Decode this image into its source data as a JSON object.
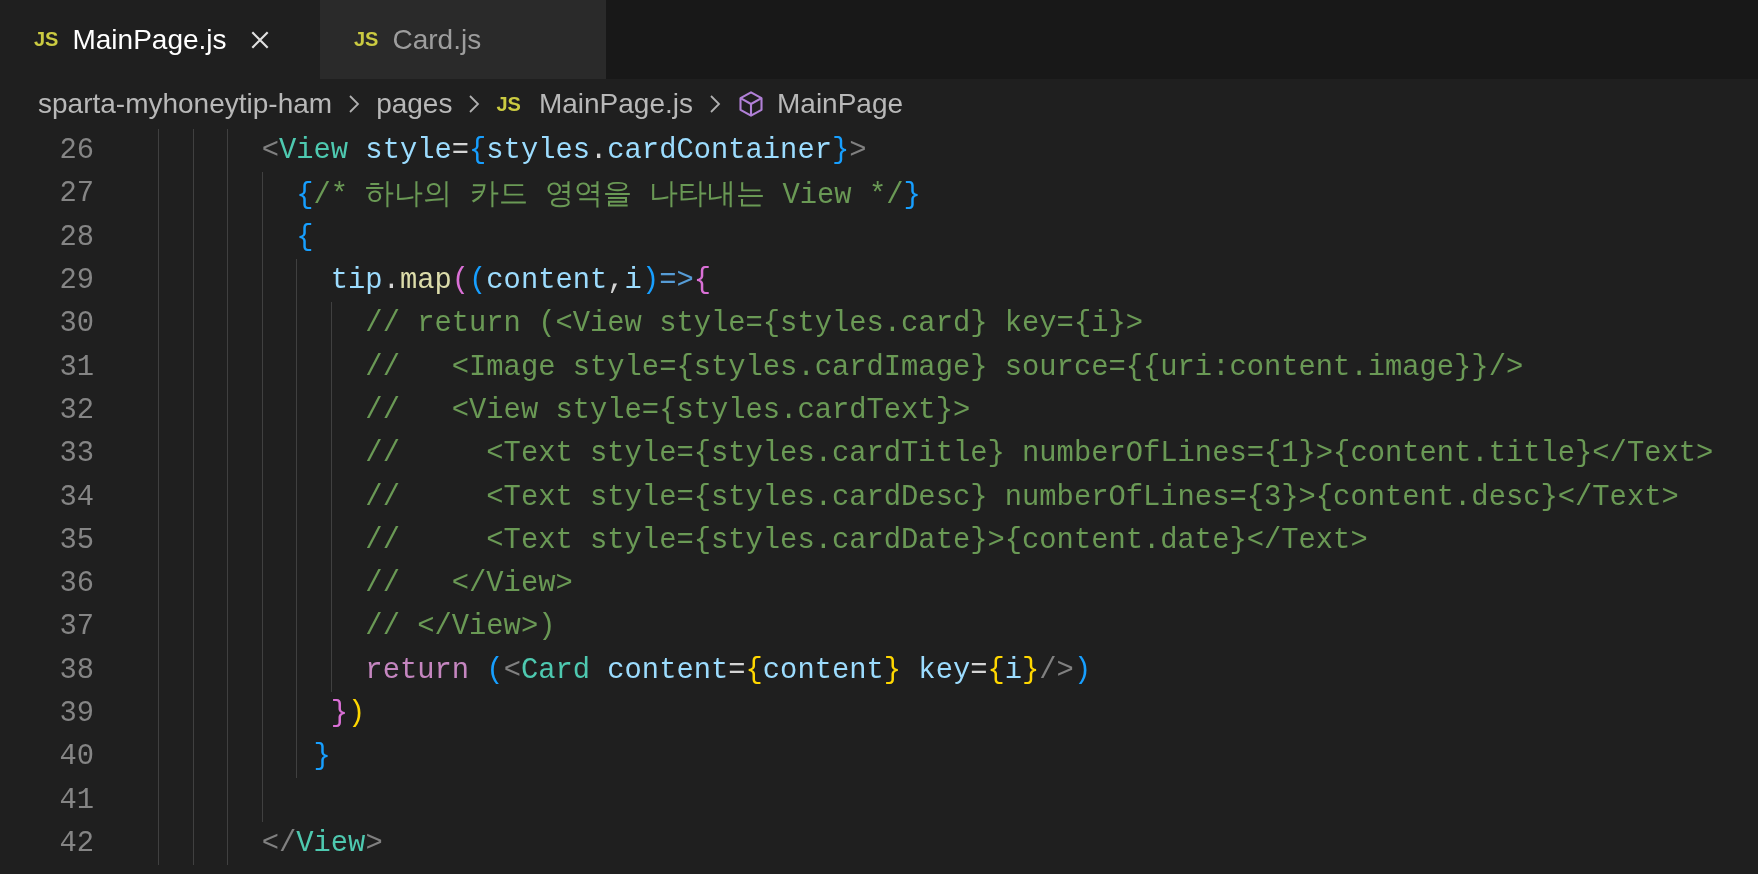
{
  "tabs": [
    {
      "icon_text": "JS",
      "label": "MainPage.js",
      "selected": true,
      "closable": true
    },
    {
      "icon_text": "JS",
      "label": "Card.js",
      "selected": false,
      "closable": false
    }
  ],
  "breadcrumbs": [
    {
      "kind": "folder",
      "label": "sparta-myhoneytip-ham"
    },
    {
      "kind": "folder",
      "label": "pages"
    },
    {
      "kind": "file",
      "icon_text": "JS",
      "label": "MainPage.js"
    },
    {
      "kind": "symbol",
      "label": "MainPage"
    }
  ],
  "code_lines": [
    {
      "number": "26",
      "tokens": [
        {
          "kind": "punct",
          "text": "      <"
        },
        {
          "kind": "tag",
          "text": "View"
        },
        {
          "kind": "attr",
          "text": " style"
        },
        {
          "kind": "op",
          "text": "="
        },
        {
          "kind": "brace-blue",
          "text": "{"
        },
        {
          "kind": "var",
          "text": "styles"
        },
        {
          "kind": "op",
          "text": "."
        },
        {
          "kind": "var",
          "text": "cardContainer"
        },
        {
          "kind": "brace-blue",
          "text": "}"
        },
        {
          "kind": "punct",
          "text": ">"
        }
      ]
    },
    {
      "number": "27",
      "tokens": [
        {
          "kind": "brace-blue",
          "text": "        {"
        },
        {
          "kind": "comment",
          "text": "/* 하나의 카드 영역을 나타내는 View */"
        },
        {
          "kind": "brace-blue",
          "text": "}"
        }
      ]
    },
    {
      "number": "28",
      "tokens": [
        {
          "kind": "brace-blue",
          "text": "        {"
        }
      ]
    },
    {
      "number": "29",
      "tokens": [
        {
          "kind": "var",
          "text": "          tip"
        },
        {
          "kind": "op",
          "text": "."
        },
        {
          "kind": "fn",
          "text": "map"
        },
        {
          "kind": "brace-pink",
          "text": "("
        },
        {
          "kind": "brace-blue",
          "text": "("
        },
        {
          "kind": "var",
          "text": "content"
        },
        {
          "kind": "op",
          "text": ","
        },
        {
          "kind": "var",
          "text": "i"
        },
        {
          "kind": "brace-blue",
          "text": ")"
        },
        {
          "kind": "arrow",
          "text": "=>"
        },
        {
          "kind": "brace-pink",
          "text": "{"
        }
      ]
    },
    {
      "number": "30",
      "tokens": [
        {
          "kind": "comment",
          "text": "            // return (<View style={styles.card} key={i}>"
        }
      ]
    },
    {
      "number": "31",
      "tokens": [
        {
          "kind": "comment",
          "text": "            //   <Image style={styles.cardImage} source={{uri:content.image}}/>"
        }
      ]
    },
    {
      "number": "32",
      "tokens": [
        {
          "kind": "comment",
          "text": "            //   <View style={styles.cardText}>"
        }
      ]
    },
    {
      "number": "33",
      "tokens": [
        {
          "kind": "comment",
          "text": "            //     <Text style={styles.cardTitle} numberOfLines={1}>{content.title}</Text>"
        }
      ]
    },
    {
      "number": "34",
      "tokens": [
        {
          "kind": "comment",
          "text": "            //     <Text style={styles.cardDesc} numberOfLines={3}>{content.desc}</Text>"
        }
      ]
    },
    {
      "number": "35",
      "tokens": [
        {
          "kind": "comment",
          "text": "            //     <Text style={styles.cardDate}>{content.date}</Text>"
        }
      ]
    },
    {
      "number": "36",
      "tokens": [
        {
          "kind": "comment",
          "text": "            //   </View>"
        }
      ]
    },
    {
      "number": "37",
      "tokens": [
        {
          "kind": "comment",
          "text": "            // </View>)"
        }
      ]
    },
    {
      "number": "38",
      "tokens": [
        {
          "kind": "keyword",
          "text": "            return"
        },
        {
          "kind": "brace-blue",
          "text": " ("
        },
        {
          "kind": "punct",
          "text": "<"
        },
        {
          "kind": "tag",
          "text": "Card"
        },
        {
          "kind": "attr",
          "text": " content"
        },
        {
          "kind": "op",
          "text": "="
        },
        {
          "kind": "brace-yellow",
          "text": "{"
        },
        {
          "kind": "var",
          "text": "content"
        },
        {
          "kind": "brace-yellow",
          "text": "}"
        },
        {
          "kind": "attr",
          "text": " key"
        },
        {
          "kind": "op",
          "text": "="
        },
        {
          "kind": "brace-yellow",
          "text": "{"
        },
        {
          "kind": "var",
          "text": "i"
        },
        {
          "kind": "brace-yellow",
          "text": "}"
        },
        {
          "kind": "punct",
          "text": "/>"
        },
        {
          "kind": "brace-blue",
          "text": ")"
        }
      ]
    },
    {
      "number": "39",
      "tokens": [
        {
          "kind": "brace-pink",
          "text": "          }"
        },
        {
          "kind": "brace-yellow",
          "text": ")"
        }
      ]
    },
    {
      "number": "40",
      "tokens": [
        {
          "kind": "brace-blue",
          "text": "         }"
        }
      ]
    },
    {
      "number": "41"
    },
    {
      "number": "42",
      "tokens": [
        {
          "kind": "punct",
          "text": "      </"
        },
        {
          "kind": "tag",
          "text": "View"
        },
        {
          "kind": "punct",
          "text": ">"
        }
      ]
    }
  ]
}
